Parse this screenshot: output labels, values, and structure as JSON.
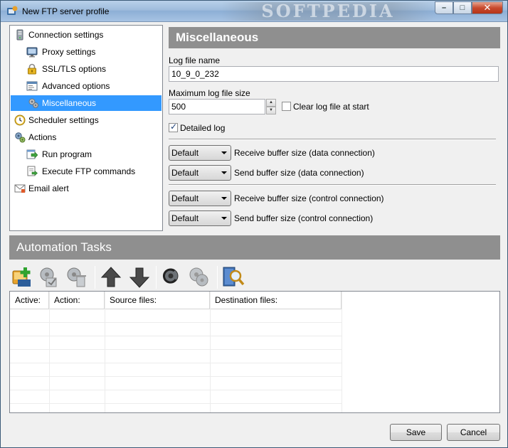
{
  "window": {
    "title": "New FTP server profile",
    "watermark": "SOFTPEDIA",
    "minimize": "–",
    "maximize": "□",
    "close": "✕"
  },
  "tree": {
    "items": [
      {
        "label": "Connection settings",
        "icon": "server-icon"
      },
      {
        "label": "Proxy settings",
        "icon": "monitor-icon"
      },
      {
        "label": "SSL/TLS options",
        "icon": "lock-icon"
      },
      {
        "label": "Advanced options",
        "icon": "window-icon"
      },
      {
        "label": "Miscellaneous",
        "icon": "gears-icon",
        "selected": true
      },
      {
        "label": "Scheduler settings",
        "icon": "clock-icon"
      },
      {
        "label": "Actions",
        "icon": "cogs-icon"
      },
      {
        "label": "Run program",
        "icon": "run-icon"
      },
      {
        "label": "Execute FTP commands",
        "icon": "script-icon"
      },
      {
        "label": "Email alert",
        "icon": "mail-icon"
      }
    ]
  },
  "misc": {
    "header": "Miscellaneous",
    "log_file_label": "Log file name",
    "log_file_value": "10_9_0_232",
    "max_size_label": "Maximum log file size",
    "max_size_value": "500",
    "clear_log_label": "Clear log file at start",
    "clear_log_checked": false,
    "detailed_log_label": "Detailed log",
    "detailed_log_checked": true,
    "buffers": [
      {
        "value": "Default",
        "label": "Receive buffer size (data connection)"
      },
      {
        "value": "Default",
        "label": "Send buffer size (data connection)"
      },
      {
        "value": "Default",
        "label": "Receive buffer size (control connection)"
      },
      {
        "value": "Default",
        "label": "Send buffer size (control connection)"
      }
    ]
  },
  "automation": {
    "header": "Automation Tasks",
    "columns": [
      "Active:",
      "Action:",
      "Source files:",
      "Destination files:"
    ]
  },
  "footer": {
    "save": "Save",
    "cancel": "Cancel"
  }
}
